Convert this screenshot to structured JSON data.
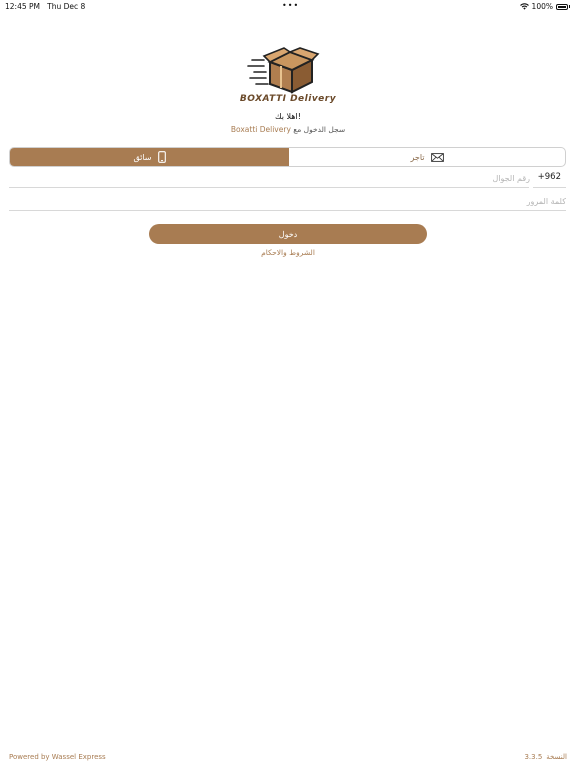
{
  "status_bar": {
    "time": "12:45 PM",
    "date": "Thu Dec 8",
    "battery": "100%",
    "dots": "•••"
  },
  "brand": {
    "name": "BOXATTI Delivery",
    "welcome": "اهلا بك!",
    "subtitle_prefix": "سجل الدخول مع",
    "subtitle_app": "Boxatti Delivery"
  },
  "tabs": {
    "driver_label": "سائق",
    "merchant_label": "تاجر",
    "active": "driver"
  },
  "form": {
    "phone_placeholder": "رقم الجوال",
    "country_code": "+962",
    "password_placeholder": "كلمة المرور"
  },
  "login_label": "دخول",
  "terms_label": "الشروط والاحكام",
  "footer": {
    "powered_by": "Powered by Wassel Express",
    "version_label": "النسخة",
    "version": "3.3.5"
  },
  "colors": {
    "accent": "#a87c52",
    "brand_dark": "#6b4a2a"
  }
}
